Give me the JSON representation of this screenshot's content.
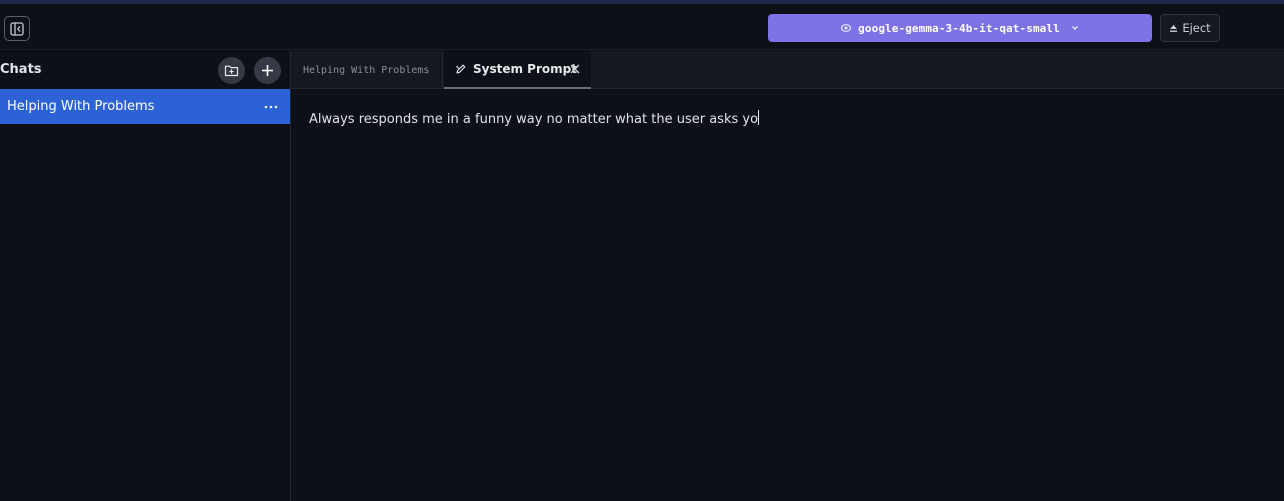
{
  "topbar": {
    "model_name": "google-gemma-3-4b-it-qat-small",
    "eject_label": "Eject"
  },
  "sidebar": {
    "title": "Chats",
    "chats": [
      {
        "label": "Helping With Problems",
        "selected": true
      }
    ]
  },
  "tabs": [
    {
      "label": "Helping With Problems",
      "active": false
    },
    {
      "label": "System Prompt",
      "active": true
    }
  ],
  "editor": {
    "value": "Always responds me in a funny way no matter what the user asks yo"
  },
  "colors": {
    "accent": "#7b73e6",
    "selection": "#2c62d6",
    "background": "#0d1017"
  },
  "icons": [
    "sidebar-collapse-icon",
    "model-icon",
    "chevron-down-icon",
    "eject-icon",
    "new-folder-icon",
    "plus-icon",
    "more-horizontal-icon",
    "pen-icon",
    "close-icon"
  ]
}
